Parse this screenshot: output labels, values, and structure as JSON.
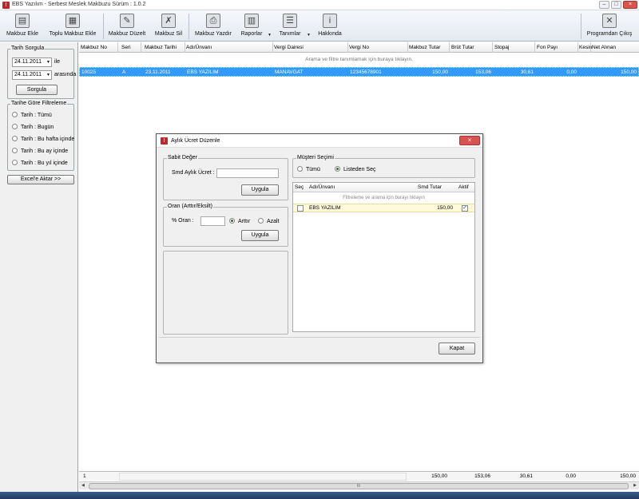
{
  "window": {
    "title": "EBS Yazılım - Serbest Meslek Makbuzu Sürüm : 1.0.2"
  },
  "toolbar": {
    "buttons": [
      {
        "label": "Makbuz Ekle",
        "icon": "add-receipt-icon"
      },
      {
        "label": "Toplu Makbuz Ekle",
        "icon": "bulk-add-icon"
      },
      {
        "label": "Makbuz Düzelt",
        "icon": "edit-receipt-icon"
      },
      {
        "label": "Makbuz Sil",
        "icon": "delete-receipt-icon"
      },
      {
        "label": "Makbuz Yazdır",
        "icon": "printer-icon"
      },
      {
        "label": "Raporlar",
        "icon": "reports-icon"
      },
      {
        "label": "Tanımlar",
        "icon": "definitions-icon"
      },
      {
        "label": "Hakkında",
        "icon": "about-icon"
      },
      {
        "label": "Programdan Çıkış",
        "icon": "exit-icon"
      }
    ]
  },
  "left_panel": {
    "date_query": {
      "title": "Tarih Sorgula",
      "start_date": "24.11.2011",
      "start_suffix": "ile",
      "end_date": "24.11.2011",
      "end_suffix": "arasında",
      "query_button": "Sorgula"
    },
    "date_filter": {
      "title": "Tarihe Göre Filtreleme",
      "options": [
        "Tarih : Tümü",
        "Tarih : Bugün",
        "Tarih : Bu hafta içinde",
        "Tarih : Bu ay içinde",
        "Tarih : Bu yıl içinde"
      ]
    },
    "export_button": "Excel'e Aktar >>"
  },
  "grid": {
    "columns": [
      "Makbuz No",
      "Seri",
      "Makbuz Tarihi",
      "Adı/Ünvanı",
      "Vergi Dairesi",
      "Vergi No",
      "Makbuz Tutar",
      "Brüt Tutar",
      "Stopaj",
      "Fon Payı",
      "Kesin",
      "Net Alınan"
    ],
    "filter_hint": "Arama ve filtre tanımlamak için buraya tıklayın.",
    "rows": [
      {
        "makbuz_no": "10025",
        "seri": "A",
        "tarih": "23.11.2011",
        "unvan": "EBS YAZILIM",
        "vergi_dairesi": "MANAVGAT",
        "vergi_no": "12345678901",
        "makbuz_tutar": "150,00",
        "brut_tutar": "153,06",
        "stopaj": "30,61",
        "fon_payi": "0,00",
        "net_alinan": "150,00"
      }
    ],
    "footer": {
      "count": "1",
      "makbuz_tutar": "150,00",
      "brut_tutar": "153,06",
      "stopaj": "30,61",
      "fon_payi": "0,00",
      "net_alinan": "150,00"
    },
    "scroll_grip": "III"
  },
  "dialog": {
    "title": "Aylık Ücret Düzenle",
    "fixed_value": {
      "title": "Sabit Değer",
      "label": "Smd Aylık Ücret :",
      "value": "",
      "apply_button": "Uygula"
    },
    "ratio": {
      "title": "Oran (Arttır/Eksilt)",
      "label": "% Oran :",
      "value": "",
      "increase_label": "Arttır",
      "decrease_label": "Azalt",
      "selected": "Arttır",
      "apply_button": "Uygula"
    },
    "customer_selection": {
      "title": "Müşteri Seçimi",
      "option_all": "Tümü",
      "option_list": "Listeden Seç",
      "selected": "Listeden Seç"
    },
    "customer_grid": {
      "columns": [
        "Seç",
        "Adı/Ünvanı",
        "Smd Tutar",
        "Aktif"
      ],
      "filter_hint": "Filtreleme ve arama için burayı tıklayın",
      "rows": [
        {
          "selected": false,
          "name": "EBS YAZILIM",
          "amount": "150,00",
          "active": true
        }
      ]
    },
    "close_button": "Kapat"
  }
}
